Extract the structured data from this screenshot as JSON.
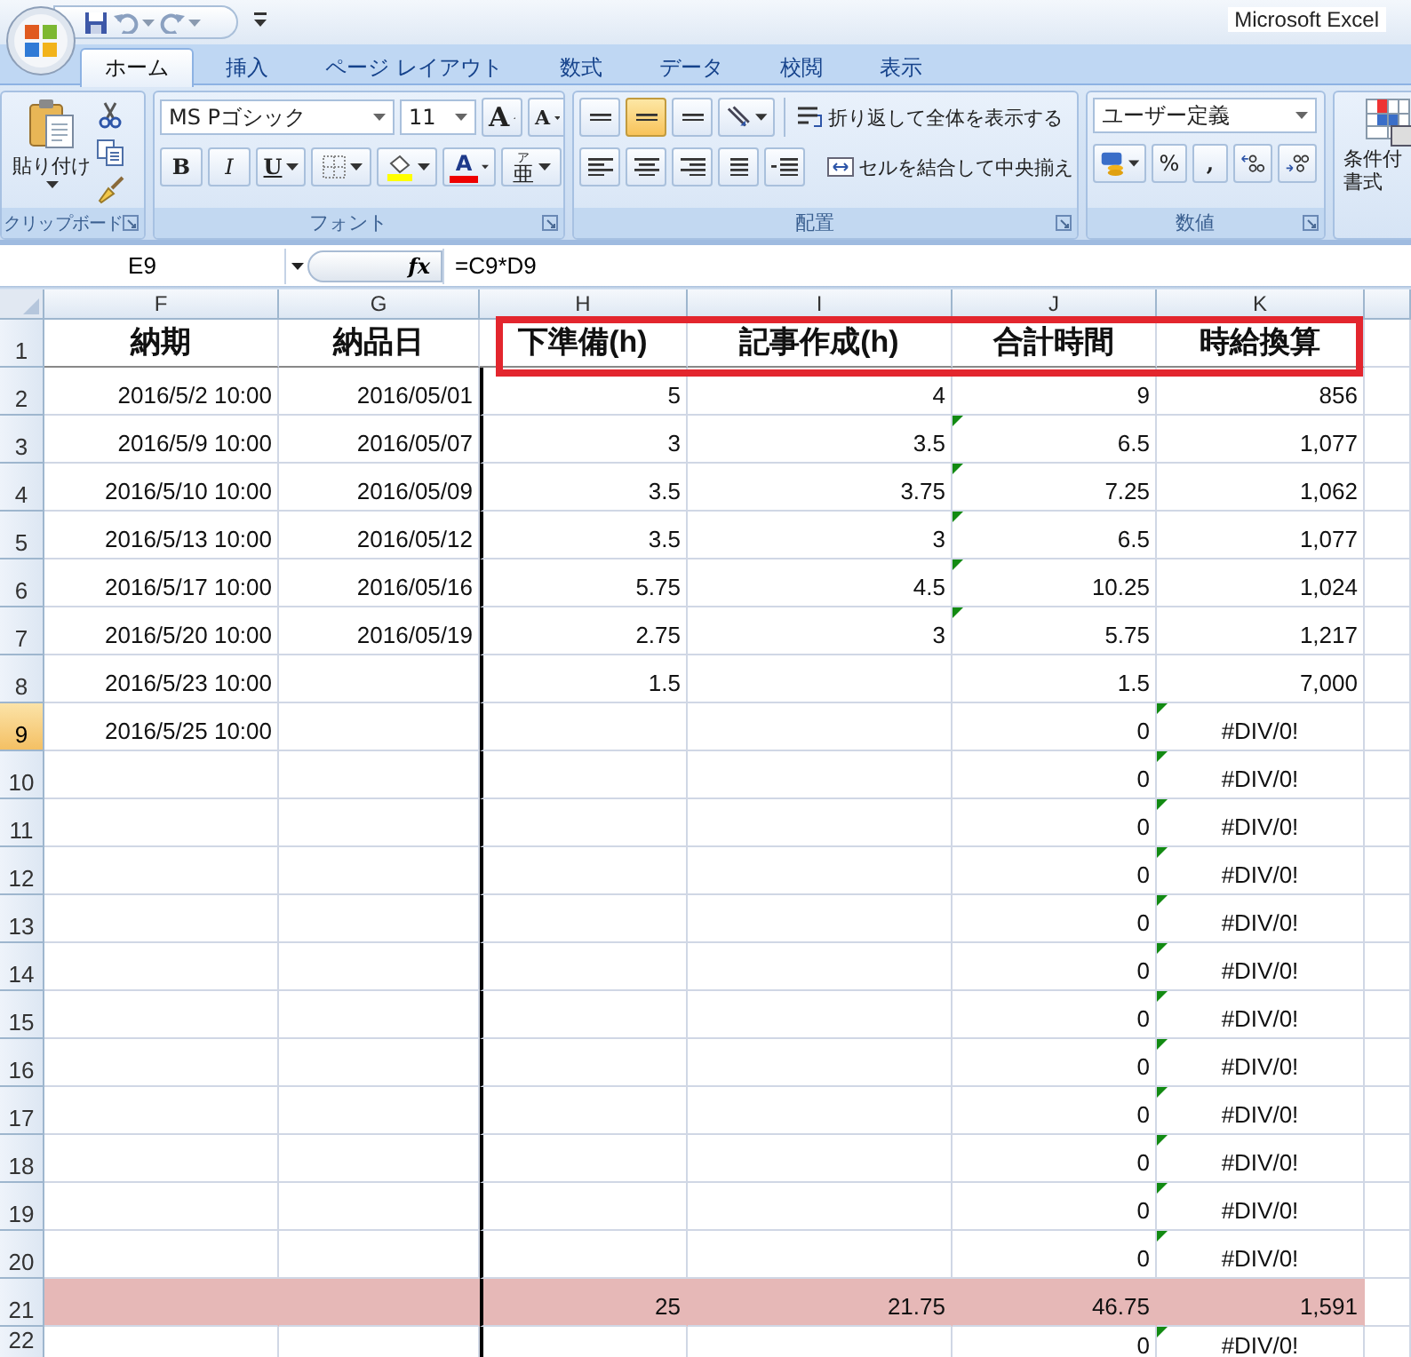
{
  "title_bar": {
    "title": "Microsoft Excel"
  },
  "tabs": [
    {
      "label": "ホーム",
      "selected": true
    },
    {
      "label": "挿入",
      "selected": false
    },
    {
      "label": "ページ レイアウト",
      "selected": false
    },
    {
      "label": "数式",
      "selected": false
    },
    {
      "label": "データ",
      "selected": false
    },
    {
      "label": "校閲",
      "selected": false
    },
    {
      "label": "表示",
      "selected": false
    }
  ],
  "ribbon": {
    "clipboard": {
      "paste": "貼り付け",
      "label": "クリップボード"
    },
    "font": {
      "font_name": "MS Pゴシック",
      "font_size": "11",
      "grow": "A",
      "shrink": "A",
      "bold": "B",
      "italic": "I",
      "underline": "U",
      "font_color": "A",
      "phonetic_guide": "ア",
      "phonetic": "亜",
      "label": "フォント"
    },
    "alignment": {
      "vertical": [
        {
          "selected": false
        },
        {
          "selected": true
        },
        {
          "selected": false
        }
      ],
      "wrap": "折り返して全体を表示する",
      "merge": "セルを結合して中央揃え",
      "label": "配置"
    },
    "number": {
      "format": "ユーザー定義",
      "percent": "%",
      "comma": ",",
      "label": "数値"
    },
    "styles": {
      "conditional": [
        "条件付",
        "書式"
      ]
    }
  },
  "formula_bar": {
    "name_box": "E9",
    "function_label": "fx",
    "formula": "=C9*D9"
  },
  "sheet": {
    "columns": [
      "F",
      "G",
      "H",
      "I",
      "J",
      "K"
    ],
    "rows": [
      {
        "header": "1",
        "kind": "heading",
        "selected": false,
        "cells": [
          "納期",
          "納品日",
          "下準備(h)",
          "記事作成(h)",
          "合計時間",
          "時給換算"
        ],
        "error_marks": [
          false,
          false,
          false,
          false,
          false,
          false
        ]
      },
      {
        "header": "2",
        "kind": "data",
        "selected": false,
        "cells": [
          "2016/5/2 10:00",
          "2016/05/01",
          "5",
          "4",
          "9",
          "856"
        ],
        "error_marks": [
          false,
          false,
          false,
          false,
          false,
          false
        ]
      },
      {
        "header": "3",
        "kind": "data",
        "selected": false,
        "cells": [
          "2016/5/9 10:00",
          "2016/05/07",
          "3",
          "3.5",
          "6.5",
          "1,077"
        ],
        "error_marks": [
          false,
          false,
          false,
          false,
          true,
          false
        ]
      },
      {
        "header": "4",
        "kind": "data",
        "selected": false,
        "cells": [
          "2016/5/10 10:00",
          "2016/05/09",
          "3.5",
          "3.75",
          "7.25",
          "1,062"
        ],
        "error_marks": [
          false,
          false,
          false,
          false,
          true,
          false
        ]
      },
      {
        "header": "5",
        "kind": "data",
        "selected": false,
        "cells": [
          "2016/5/13 10:00",
          "2016/05/12",
          "3.5",
          "3",
          "6.5",
          "1,077"
        ],
        "error_marks": [
          false,
          false,
          false,
          false,
          true,
          false
        ]
      },
      {
        "header": "6",
        "kind": "data",
        "selected": false,
        "cells": [
          "2016/5/17 10:00",
          "2016/05/16",
          "5.75",
          "4.5",
          "10.25",
          "1,024"
        ],
        "error_marks": [
          false,
          false,
          false,
          false,
          true,
          false
        ]
      },
      {
        "header": "7",
        "kind": "data",
        "selected": false,
        "cells": [
          "2016/5/20 10:00",
          "2016/05/19",
          "2.75",
          "3",
          "5.75",
          "1,217"
        ],
        "error_marks": [
          false,
          false,
          false,
          false,
          true,
          false
        ]
      },
      {
        "header": "8",
        "kind": "data",
        "selected": false,
        "cells": [
          "2016/5/23 10:00",
          null,
          "1.5",
          null,
          "1.5",
          "7,000"
        ],
        "error_marks": [
          false,
          false,
          false,
          false,
          false,
          false
        ]
      },
      {
        "header": "9",
        "kind": "error",
        "selected": true,
        "cells": [
          "2016/5/25 10:00",
          null,
          null,
          null,
          "0",
          "#DIV/0!"
        ],
        "error_marks": [
          false,
          false,
          false,
          false,
          false,
          true
        ]
      },
      {
        "header": "10",
        "kind": "error",
        "selected": false,
        "cells": [
          null,
          null,
          null,
          null,
          "0",
          "#DIV/0!"
        ],
        "error_marks": [
          false,
          false,
          false,
          false,
          false,
          true
        ]
      },
      {
        "header": "11",
        "kind": "error",
        "selected": false,
        "cells": [
          null,
          null,
          null,
          null,
          "0",
          "#DIV/0!"
        ],
        "error_marks": [
          false,
          false,
          false,
          false,
          false,
          true
        ]
      },
      {
        "header": "12",
        "kind": "error",
        "selected": false,
        "cells": [
          null,
          null,
          null,
          null,
          "0",
          "#DIV/0!"
        ],
        "error_marks": [
          false,
          false,
          false,
          false,
          false,
          true
        ]
      },
      {
        "header": "13",
        "kind": "error",
        "selected": false,
        "cells": [
          null,
          null,
          null,
          null,
          "0",
          "#DIV/0!"
        ],
        "error_marks": [
          false,
          false,
          false,
          false,
          false,
          true
        ]
      },
      {
        "header": "14",
        "kind": "error",
        "selected": false,
        "cells": [
          null,
          null,
          null,
          null,
          "0",
          "#DIV/0!"
        ],
        "error_marks": [
          false,
          false,
          false,
          false,
          false,
          true
        ]
      },
      {
        "header": "15",
        "kind": "error",
        "selected": false,
        "cells": [
          null,
          null,
          null,
          null,
          "0",
          "#DIV/0!"
        ],
        "error_marks": [
          false,
          false,
          false,
          false,
          false,
          true
        ]
      },
      {
        "header": "16",
        "kind": "error",
        "selected": false,
        "cells": [
          null,
          null,
          null,
          null,
          "0",
          "#DIV/0!"
        ],
        "error_marks": [
          false,
          false,
          false,
          false,
          false,
          true
        ]
      },
      {
        "header": "17",
        "kind": "error",
        "selected": false,
        "cells": [
          null,
          null,
          null,
          null,
          "0",
          "#DIV/0!"
        ],
        "error_marks": [
          false,
          false,
          false,
          false,
          false,
          true
        ]
      },
      {
        "header": "18",
        "kind": "error",
        "selected": false,
        "cells": [
          null,
          null,
          null,
          null,
          "0",
          "#DIV/0!"
        ],
        "error_marks": [
          false,
          false,
          false,
          false,
          false,
          true
        ]
      },
      {
        "header": "19",
        "kind": "error",
        "selected": false,
        "cells": [
          null,
          null,
          null,
          null,
          "0",
          "#DIV/0!"
        ],
        "error_marks": [
          false,
          false,
          false,
          false,
          false,
          true
        ]
      },
      {
        "header": "20",
        "kind": "error",
        "selected": false,
        "cells": [
          null,
          null,
          null,
          null,
          "0",
          "#DIV/0!"
        ],
        "error_marks": [
          false,
          false,
          false,
          false,
          false,
          true
        ]
      },
      {
        "header": "21",
        "kind": "total",
        "selected": false,
        "cells": [
          null,
          null,
          "25",
          "21.75",
          "46.75",
          "1,591"
        ],
        "error_marks": [
          false,
          false,
          false,
          false,
          false,
          false
        ]
      },
      {
        "header": "22",
        "kind": "error",
        "selected": false,
        "cells": [
          null,
          null,
          null,
          null,
          "0",
          "#DIV/0!"
        ],
        "error_marks": [
          false,
          false,
          false,
          false,
          false,
          true
        ]
      }
    ]
  }
}
